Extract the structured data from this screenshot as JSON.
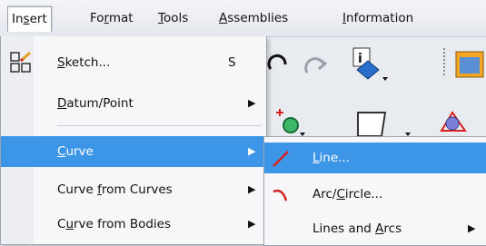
{
  "menubar": {
    "items": [
      {
        "label_pre": "In",
        "label_u": "s",
        "label_post": "ert"
      },
      {
        "label_pre": "Fo",
        "label_u": "r",
        "label_post": "mat"
      },
      {
        "label_pre": "",
        "label_u": "T",
        "label_post": "ools"
      },
      {
        "label_pre": "",
        "label_u": "A",
        "label_post": "ssemblies"
      },
      {
        "label_pre": "",
        "label_u": "I",
        "label_post": "nformation"
      }
    ]
  },
  "insert_menu": {
    "items": [
      {
        "label_pre": "",
        "label_u": "S",
        "label_post": "ketch...",
        "shortcut": "S",
        "icon": "sketch-icon"
      },
      {
        "label_pre": "",
        "label_u": "D",
        "label_post": "atum/Point",
        "arrow": "▶"
      },
      {
        "label_pre": "",
        "label_u": "C",
        "label_post": "urve",
        "arrow": "▶"
      },
      {
        "label_pre": "Curve ",
        "label_u": "f",
        "label_post": "rom Curves",
        "arrow": "▶"
      },
      {
        "label_pre": "C",
        "label_u": "u",
        "label_post": "rve from Bodies",
        "arrow": "▶"
      }
    ]
  },
  "curve_submenu": {
    "items": [
      {
        "label_pre": "",
        "label_u": "L",
        "label_post": "ine...",
        "icon": "line-icon"
      },
      {
        "label_pre": "Arc/",
        "label_u": "C",
        "label_post": "ircle...",
        "icon": "arc-circle-icon"
      },
      {
        "label_pre": "Lines and ",
        "label_u": "A",
        "label_post": "rcs",
        "arrow": "▶"
      }
    ]
  },
  "colors": {
    "highlight": "#3d95e8",
    "line_icon": "#d62020"
  }
}
